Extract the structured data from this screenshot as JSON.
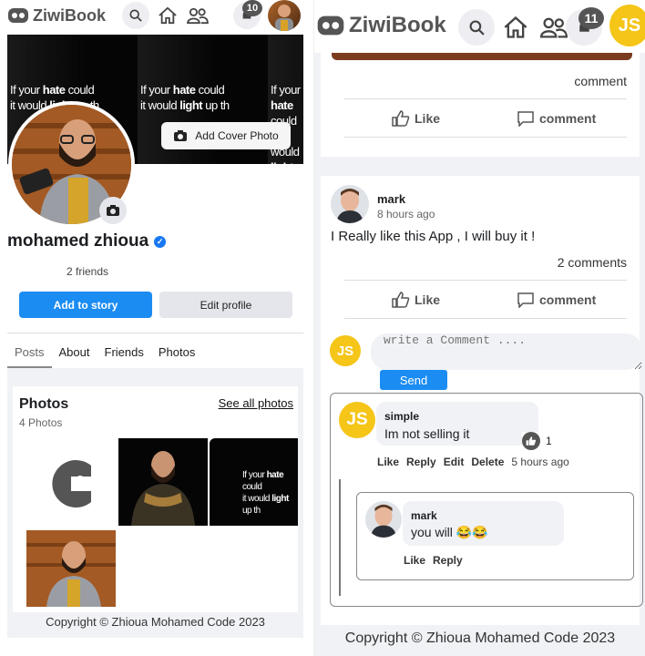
{
  "left": {
    "nav": {
      "app_name": "ZiwiBook",
      "notifications_count": "10"
    },
    "cover": {
      "quote_line1_pre": "If your ",
      "quote_line1_bold": "hate",
      "quote_line1_post": " could",
      "quote_line2_pre": "it would ",
      "quote_line2_bold": "light",
      "quote_line2_post": " up th",
      "add_cover_label": "Add Cover Photo"
    },
    "profile": {
      "name": "mohamed zhioua",
      "friends": "2 friends",
      "add_story": "Add to story",
      "edit_profile": "Edit profile"
    },
    "tabs": [
      "Posts",
      "About",
      "Friends",
      "Photos"
    ],
    "photos": {
      "title": "Photos",
      "count": "4 Photos",
      "see_all": "See all photos"
    },
    "copyright": "Copyright © Zhioua Mohamed Code 2023"
  },
  "right": {
    "nav": {
      "app_name": "ZiwiBook",
      "notifications_count": "11",
      "avatar_initials": "JS"
    },
    "post1": {
      "comment_count": "comment",
      "like_label": "Like",
      "comment_label": "comment"
    },
    "post2": {
      "author": "mark",
      "time": "8 hours ago",
      "text": "I Really like this App , I will buy it !",
      "comment_count": "2 comments",
      "like_label": "Like",
      "comment_label": "comment",
      "input_placeholder": "write a Comment ....",
      "input_avatar": "JS",
      "send_label": "Send"
    },
    "comment": {
      "avatar": "JS",
      "author": "simple",
      "text": "Im not selling it",
      "likes": "1",
      "actions": {
        "like": "Like",
        "reply": "Reply",
        "edit": "Edit",
        "delete": "Delete"
      },
      "time": "5 hours ago"
    },
    "reply": {
      "author": "mark",
      "text": "you will 😂😂",
      "actions": {
        "like": "Like",
        "reply": "Reply"
      }
    },
    "copyright": "Copyright © Zhioua Mohamed Code 2023"
  },
  "colors": {
    "primary": "#1b8cf2",
    "avatar_yellow": "#f5c518",
    "grey_bg": "#f0f2f5",
    "verified": "#1877f2"
  },
  "icons": [
    "logo-icon",
    "search-icon",
    "home-icon",
    "friends-icon",
    "notification-icon",
    "camera-icon",
    "verified-icon",
    "like-icon",
    "comment-icon",
    "thumbs-up-icon"
  ]
}
